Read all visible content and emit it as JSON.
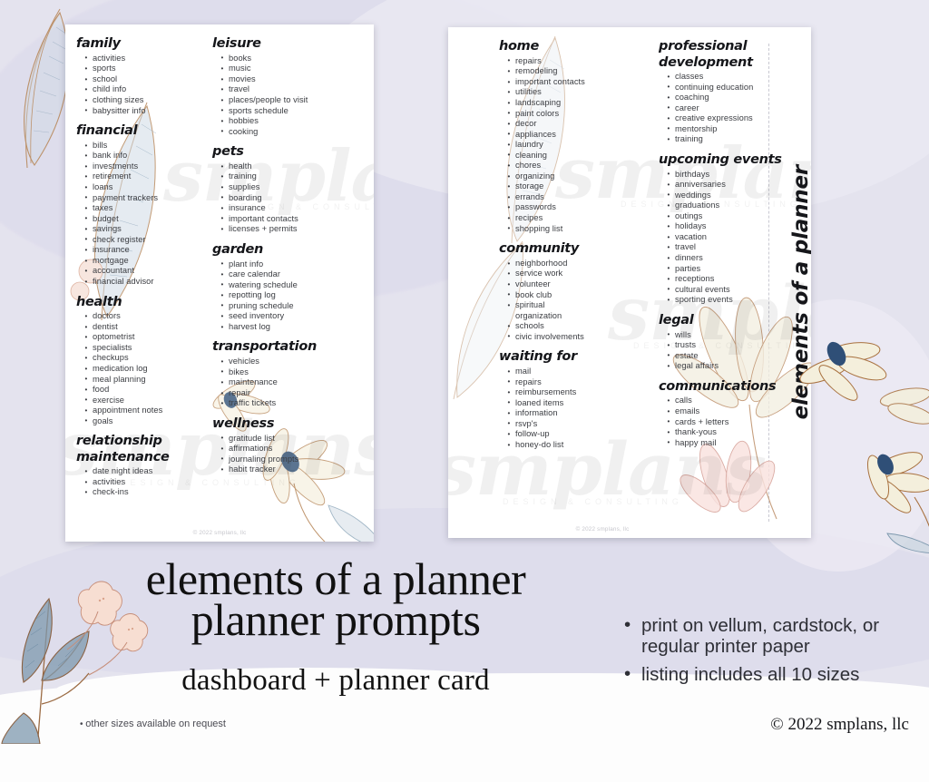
{
  "theme": {
    "background": "#e4e3ee",
    "card_background": "#ffffff",
    "text_dark": "#15161a",
    "text_body": "#3b3d42",
    "watermark_color": "#000000",
    "floral_blue": "#41618a",
    "floral_pink": "#f3ddd6",
    "floral_brown": "#b07b4e",
    "leaf_teal": "#6d8ca3"
  },
  "watermark": {
    "brand": "smplans",
    "tagline": "DESIGN & CONSULTING"
  },
  "cards": [
    {
      "name": "dashboard-card",
      "credit": "© 2022 smplans, llc",
      "columns": [
        {
          "name": "column-1",
          "sections": [
            {
              "title": "family",
              "items": [
                "activities",
                "sports",
                "school",
                "child info",
                "clothing sizes",
                "babysitter info"
              ]
            },
            {
              "title": "financial",
              "items": [
                "bills",
                "bank info",
                "investments",
                "retirement",
                "loans",
                "payment trackers",
                "taxes",
                "budget",
                "savings",
                "check register",
                "insurance",
                "mortgage",
                "accountant",
                "financial advisor"
              ]
            },
            {
              "title": "health",
              "items": [
                "doctors",
                "dentist",
                "optometrist",
                "specialists",
                "checkups",
                "medication log",
                "meal planning",
                "food",
                "exercise",
                "appointment notes",
                "goals"
              ]
            },
            {
              "title": "relationship maintenance",
              "title_line1": "relationship",
              "title_line2": "maintenance",
              "items": [
                "date night ideas",
                "activities",
                "check-ins"
              ]
            }
          ]
        },
        {
          "name": "column-2",
          "sections": [
            {
              "title": "leisure",
              "items": [
                "books",
                "music",
                "movies",
                "travel",
                "places/people to visit",
                "sports schedule",
                "hobbies",
                "cooking"
              ]
            },
            {
              "title": "pets",
              "items": [
                "health",
                "training",
                "supplies",
                "boarding",
                "insurance",
                "important contacts",
                "licenses + permits"
              ]
            },
            {
              "title": "garden",
              "items": [
                "plant info",
                "care calendar",
                "watering schedule",
                "repotting log",
                "pruning schedule",
                "seed inventory",
                "harvest log"
              ]
            },
            {
              "title": "transportation",
              "items": [
                "vehicles",
                "bikes",
                "maintenance",
                "repair",
                "traffic tickets"
              ]
            },
            {
              "title": "wellness",
              "items": [
                "gratitude list",
                "affirmations",
                "journaling prompts",
                "habit tracker"
              ]
            }
          ]
        }
      ]
    },
    {
      "name": "planner-card",
      "credit": "© 2022 smplans, llc",
      "side_title": "elements of a planner",
      "columns": [
        {
          "name": "column-1",
          "sections": [
            {
              "title": "home",
              "items": [
                "repairs",
                "remodeling",
                "important contacts",
                "utilities",
                "landscaping",
                "paint colors",
                "decor",
                "appliances",
                "laundry",
                "cleaning",
                "chores",
                "organizing",
                "storage",
                "errands",
                "passwords",
                "recipes",
                "shopping list"
              ]
            },
            {
              "title": "community",
              "items": [
                "neighborhood",
                "service work",
                "volunteer",
                "book club",
                "spiritual",
                "organization",
                "schools",
                "civic involvements"
              ],
              "continuation_indexes": [
                5
              ]
            },
            {
              "title": "waiting for",
              "items": [
                "mail",
                "repairs",
                "reimbursements",
                "loaned items",
                "information",
                "rsvp's",
                "follow-up",
                "honey-do list"
              ]
            }
          ]
        },
        {
          "name": "column-2",
          "sections": [
            {
              "title": "professional development",
              "title_line1": "professional",
              "title_line2": "development",
              "items": [
                "classes",
                "continuing education",
                "coaching",
                "career",
                "creative expressions",
                "mentorship",
                "training"
              ]
            },
            {
              "title": "upcoming events",
              "items": [
                "birthdays",
                "anniversaries",
                "weddings",
                "graduations",
                "outings",
                "holidays",
                "vacation",
                "travel",
                "dinners",
                "parties",
                "receptions",
                "cultural events",
                "sporting events"
              ]
            },
            {
              "title": "legal",
              "items": [
                "wills",
                "trusts",
                "estate",
                "legal affairs"
              ]
            },
            {
              "title": "communications",
              "items": [
                "calls",
                "emails",
                "cards + letters",
                "thank-yous",
                "happy mail"
              ]
            }
          ]
        }
      ]
    }
  ],
  "bottom": {
    "title_line1": "elements of a planner",
    "title_line2": "planner prompts",
    "subtitle": "dashboard  +  planner card",
    "note": "other sizes available on request",
    "bullets": [
      "print on vellum, cardstock, or regular printer paper",
      "listing includes all 10 sizes"
    ],
    "copyright": "© 2022 smplans, llc"
  }
}
